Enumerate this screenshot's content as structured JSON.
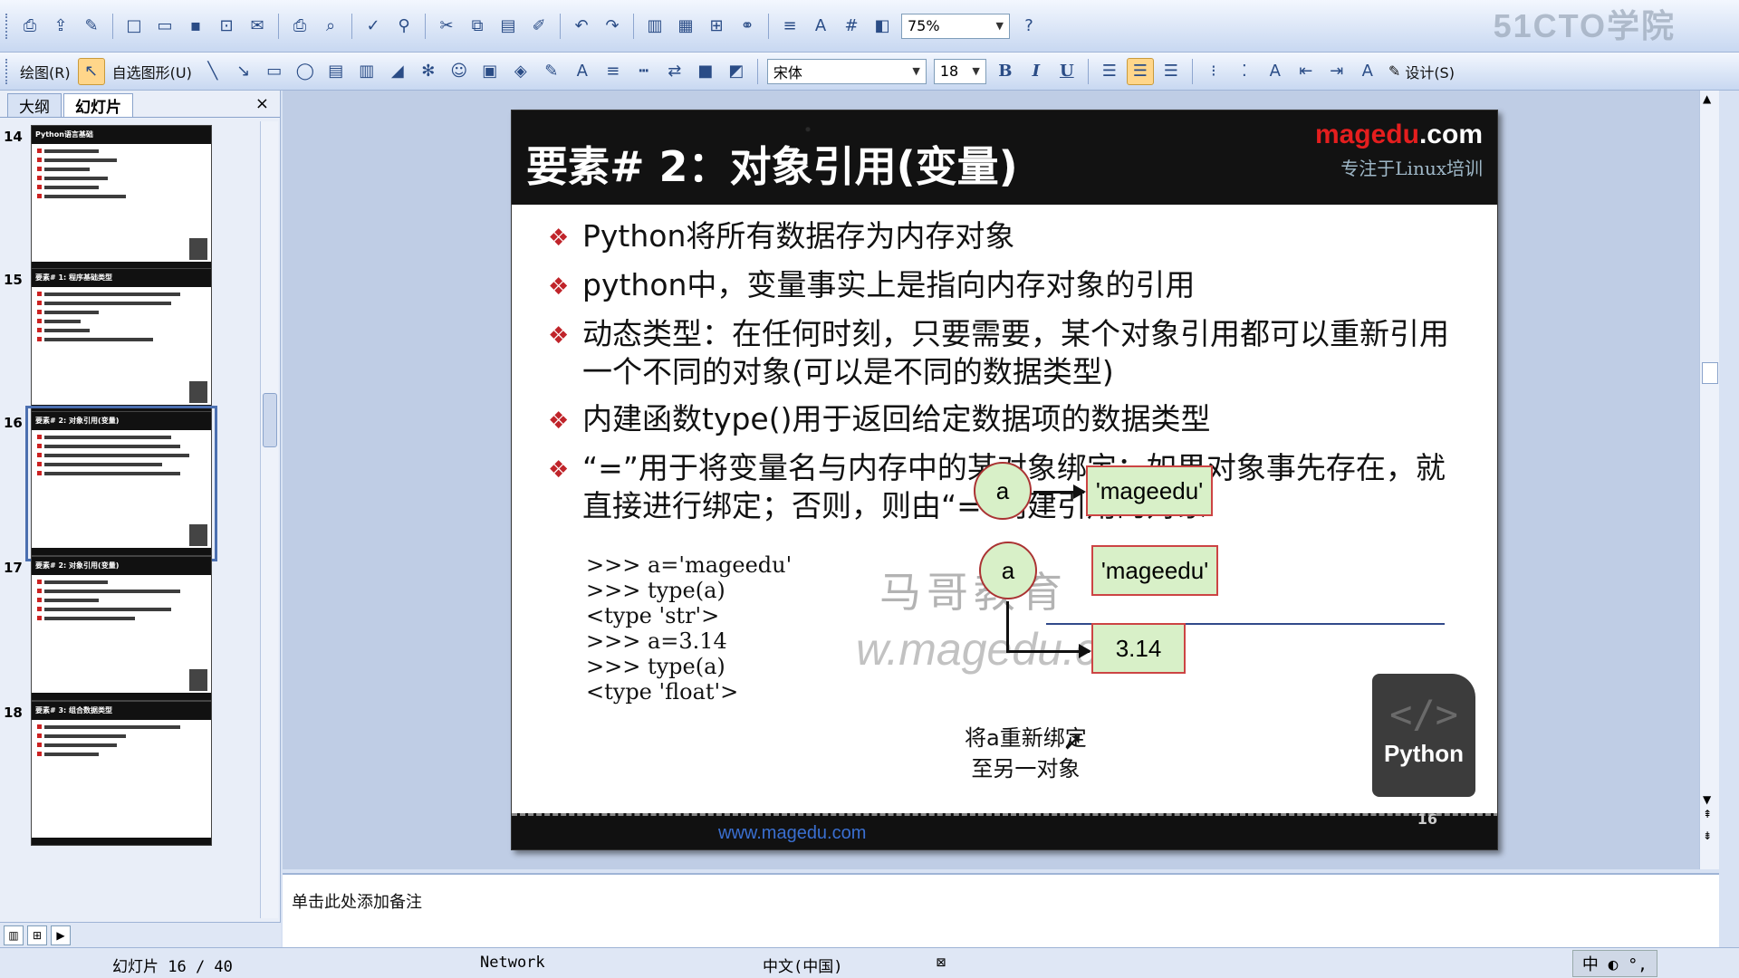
{
  "toolbar": {
    "zoom": "75%",
    "draw_menu": "绘图(R)",
    "autoshape_menu": "自选图形(U)",
    "font_name": "宋体",
    "font_size": "18",
    "bold": "B",
    "italic": "I",
    "underline": "U",
    "design_button": "设计(S)",
    "brand_watermark": "51CTO学院"
  },
  "panel": {
    "tab_outline": "大纲",
    "tab_slides": "幻灯片",
    "close": "×",
    "thumbnails": [
      {
        "num": "14",
        "title": "Python语言基础"
      },
      {
        "num": "15",
        "title": "要素# 1: 程序基础类型"
      },
      {
        "num": "16",
        "title": "要素# 2: 对象引用(变量)"
      },
      {
        "num": "17",
        "title": "要素# 2: 对象引用(变量)"
      },
      {
        "num": "18",
        "title": "要素# 3: 组合数据类型"
      }
    ]
  },
  "slide": {
    "title": "要素# 2：对象引用(变量)",
    "brand_main": "magedu",
    "brand_dot": ".com",
    "brand_sub": "专注于Linux培训",
    "bullets": [
      "Python将所有数据存为内存对象",
      "python中，变量事实上是指向内存对象的引用",
      "动态类型：在任何时刻，只要需要，某个对象引用都可以重新引用一个不同的对象(可以是不同的数据类型)",
      "内建函数type()用于返回给定数据项的数据类型",
      "“=”用于将变量名与内存中的某对象绑定：如果对象事先存在，就直接进行绑定；否则，则由“=”创建引用的对象"
    ],
    "code_lines": [
      ">>> a='mageedu'",
      ">>> type(a)",
      "<type 'str'>",
      ">>> a=3.14",
      ">>> type(a)",
      "<type 'float'>"
    ],
    "watermark_cn": "马哥教育",
    "watermark_url": "w.magedu.com",
    "diagram": {
      "var1": "a",
      "obj1": "'mageedu'",
      "var2": "a",
      "obj2": "'mageedu'",
      "obj3": "3.14",
      "rebind_line1": "将a重新绑定",
      "rebind_line2": "至另一对象"
    },
    "python_badge_icon": "</>",
    "python_badge_label": "Python",
    "footer_url": "www.magedu.com",
    "page_number": "16"
  },
  "notes": {
    "placeholder": "单击此处添加备注"
  },
  "status": {
    "slide_counter": "幻灯片 16 / 40",
    "network": "Network",
    "language": "中文(中国)",
    "ime": "中 ◐ °,"
  }
}
